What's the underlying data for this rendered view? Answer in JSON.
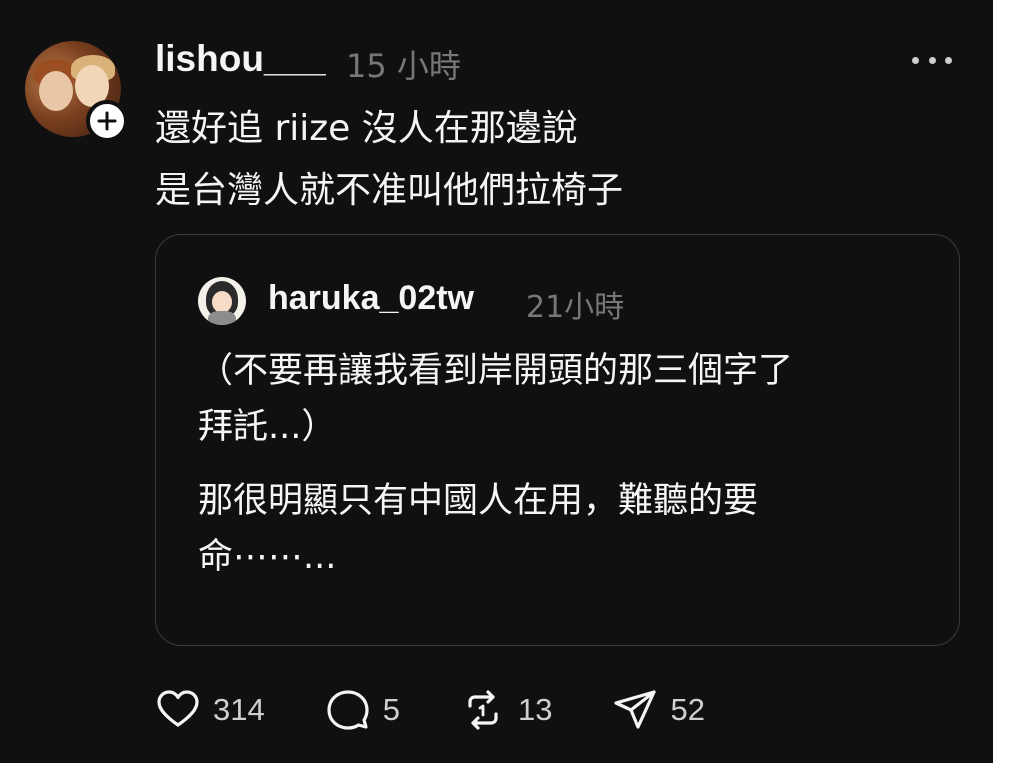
{
  "post": {
    "username": "lishou___",
    "time": "15 小時",
    "lines": [
      "還好追 riize 沒人在那邊說",
      "是台灣人就不准叫他們拉椅子"
    ]
  },
  "quote": {
    "username": "haruka_02tw",
    "time": "21小時",
    "paragraph1": [
      "（不要再讓我看到岸開頭的那三個字了",
      "拜託...）"
    ],
    "paragraph2": [
      "那很明顯只有中國人在用，難聽的要",
      "命⋯⋯..."
    ]
  },
  "actions": {
    "likes": "314",
    "replies": "5",
    "reposts": "13",
    "shares": "52"
  },
  "icons": {
    "more": "more-icon",
    "like": "heart-icon",
    "reply": "comment-icon",
    "repost": "repost-icon",
    "share": "send-icon"
  },
  "colors": {
    "background": "#101010",
    "text": "#f3f5f7",
    "muted": "#777777",
    "border": "#3a3a3a"
  }
}
